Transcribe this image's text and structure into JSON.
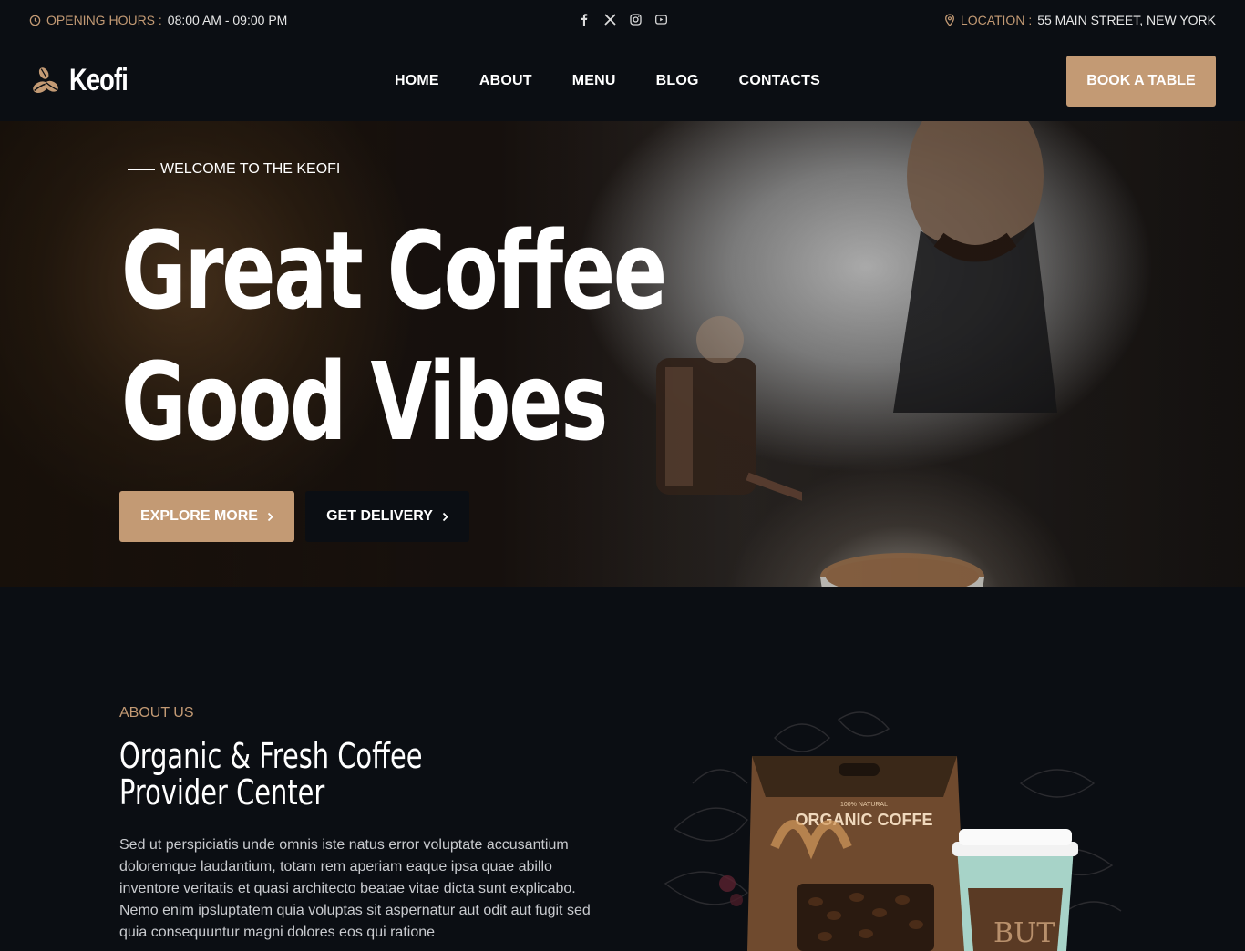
{
  "topbar": {
    "hours_label": "OPENING HOURS :",
    "hours_value": "08:00 AM - 09:00 PM",
    "location_label": "LOCATION :",
    "location_value": "55 MAIN STREET, NEW YORK",
    "social": [
      "facebook-icon",
      "x-icon",
      "instagram-icon",
      "youtube-icon"
    ]
  },
  "header": {
    "logo_text": "Keofi",
    "nav": [
      "HOME",
      "ABOUT",
      "MENU",
      "BLOG",
      "CONTACTS"
    ],
    "cta": "BOOK A TABLE"
  },
  "hero": {
    "eyebrow": "WELCOME TO THE KEOFI",
    "headline_line1": "Great Coffee",
    "headline_line2": "Good Vibes",
    "primary_btn": "EXPLORE MORE",
    "secondary_btn": "GET DELIVERY"
  },
  "about": {
    "label": "ABOUT US",
    "title_line1": "Organic & Fresh Coffee",
    "title_line2": "Provider Center",
    "text": "Sed ut perspiciatis unde omnis iste natus error voluptate accusantium doloremque laudantium, totam rem aperiam eaque ipsa quae abillo inventore veritatis et quasi architecto beatae vitae dicta sunt explicabo. Nemo enim ipsluptatem quia voluptas sit aspernatur aut odit aut fugit sed quia consequuntur magni dolores eos qui ratione",
    "product_bag_small": "100% NATURAL",
    "product_bag_big": "ORGANIC COFFE"
  },
  "colors": {
    "accent": "#c39a74",
    "background": "#0b0e13"
  }
}
